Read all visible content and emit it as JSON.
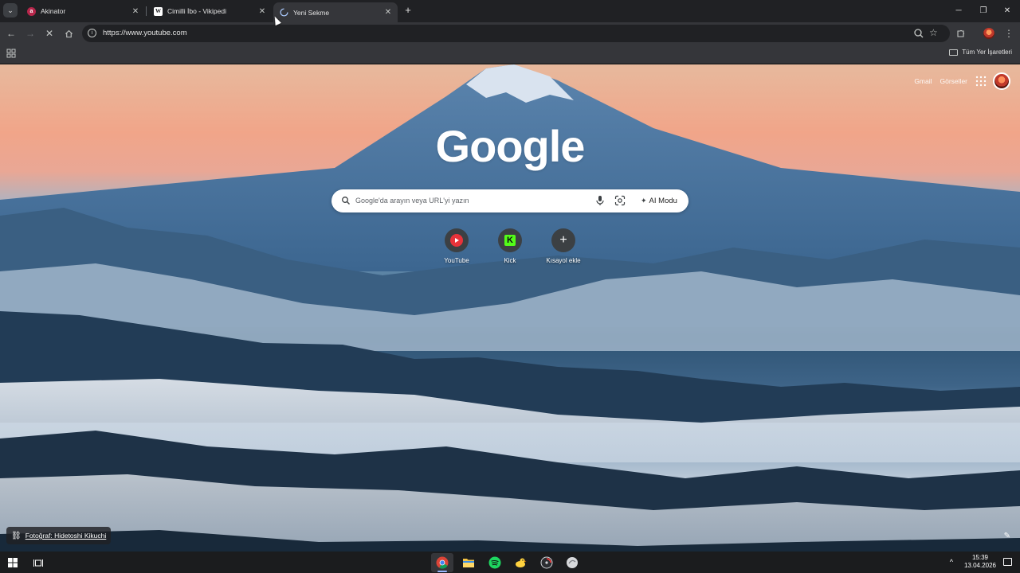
{
  "browser": {
    "tabs": [
      {
        "title": "Akinator",
        "icon": "akinator-favicon",
        "active": false
      },
      {
        "title": "Cimilli İbo - Vikipedi",
        "icon": "wikipedia-favicon",
        "active": false
      },
      {
        "title": "Yeni Sekme",
        "icon": "loading-spinner-icon",
        "active": true
      }
    ],
    "url": "https://www.youtube.com",
    "bookmarks_all_label": "Tüm Yer İşaretleri"
  },
  "ntp": {
    "top_links": {
      "gmail": "Gmail",
      "images": "Görseller"
    },
    "logo": "Google",
    "search": {
      "placeholder": "Google'da arayın veya URL'yi yazın",
      "ai_mode_label": "AI Modu"
    },
    "shortcuts": [
      {
        "label": "YouTube",
        "icon": "youtube-icon"
      },
      {
        "label": "Kick",
        "icon": "kick-icon"
      },
      {
        "label": "Kısayol ekle",
        "icon": "plus-icon"
      }
    ],
    "photo_credit": "Fotoğraf: Hidetoshi Kikuchi"
  },
  "taskbar": {
    "time": "15:39",
    "date": "13.04.2026",
    "apps": [
      "chrome-icon",
      "file-explorer-icon",
      "spotify-icon",
      "duck-app-icon",
      "steam-like-icon",
      "app-icon"
    ]
  },
  "colors": {
    "tab_active_bg": "#35363a",
    "chrome_bg": "#202124",
    "youtube_red": "#e8333a",
    "kick_green": "#53fc18",
    "spotify_green": "#1ed760"
  }
}
